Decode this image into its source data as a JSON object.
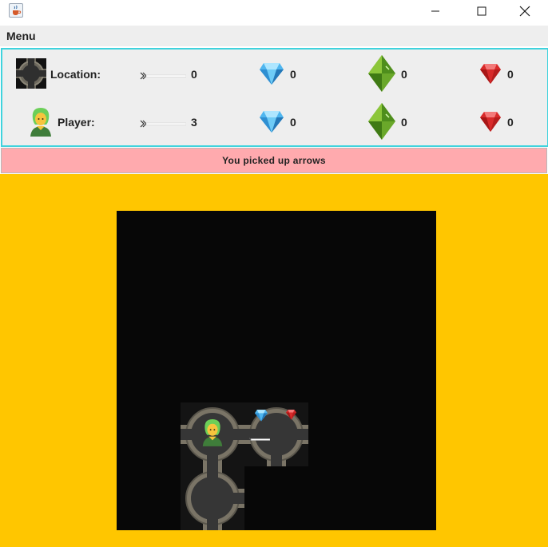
{
  "window": {
    "icon": "java-cup-icon",
    "controls": [
      "minimize-icon",
      "maximize-icon",
      "close-icon"
    ]
  },
  "menu": {
    "label": "Menu"
  },
  "stats": {
    "location": {
      "label": "Location:",
      "arrows": "0",
      "diamonds": "0",
      "emeralds": "0",
      "rubies": "0"
    },
    "player": {
      "label": "Player:",
      "arrows": "3",
      "diamonds": "0",
      "emeralds": "0",
      "rubies": "0"
    }
  },
  "status_message": "You picked up arrows",
  "colors": {
    "game_background": "#ffc600",
    "message_background": "#ffaaae",
    "panel_border": "#3fd3dd",
    "map_background": "#070707"
  },
  "map": {
    "icons": [
      "room-tile",
      "player-avatar-icon",
      "diamond-icon",
      "ruby-icon",
      "arrow-icon"
    ]
  }
}
